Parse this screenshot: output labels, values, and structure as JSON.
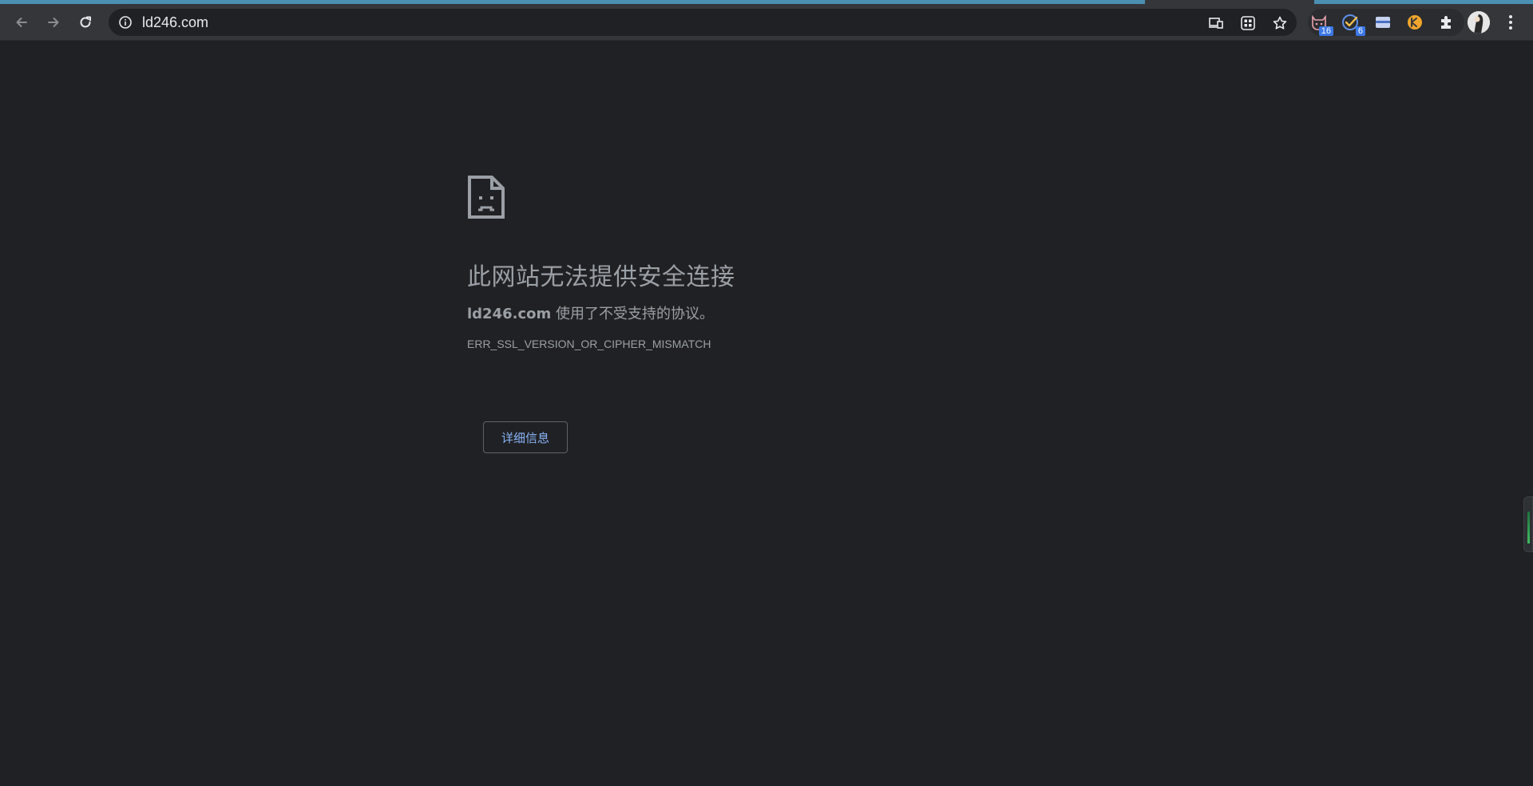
{
  "browser": {
    "url": "ld246.com",
    "extensions": [
      {
        "name": "cat-extension",
        "badge": "16"
      },
      {
        "name": "check-extension",
        "badge": "6"
      },
      {
        "name": "card-extension",
        "badge": ""
      },
      {
        "name": "orange-extension",
        "badge": ""
      }
    ],
    "colors": {
      "accent": "#4b8fb3",
      "toolbar": "#35363a",
      "page": "#202124",
      "link": "#8ab4f8"
    }
  },
  "error_page": {
    "title": "此网站无法提供安全连接",
    "host": "ld246.com",
    "message": " 使用了不受支持的协议。",
    "code": "ERR_SSL_VERSION_OR_CIPHER_MISMATCH",
    "details_button": "详细信息"
  }
}
